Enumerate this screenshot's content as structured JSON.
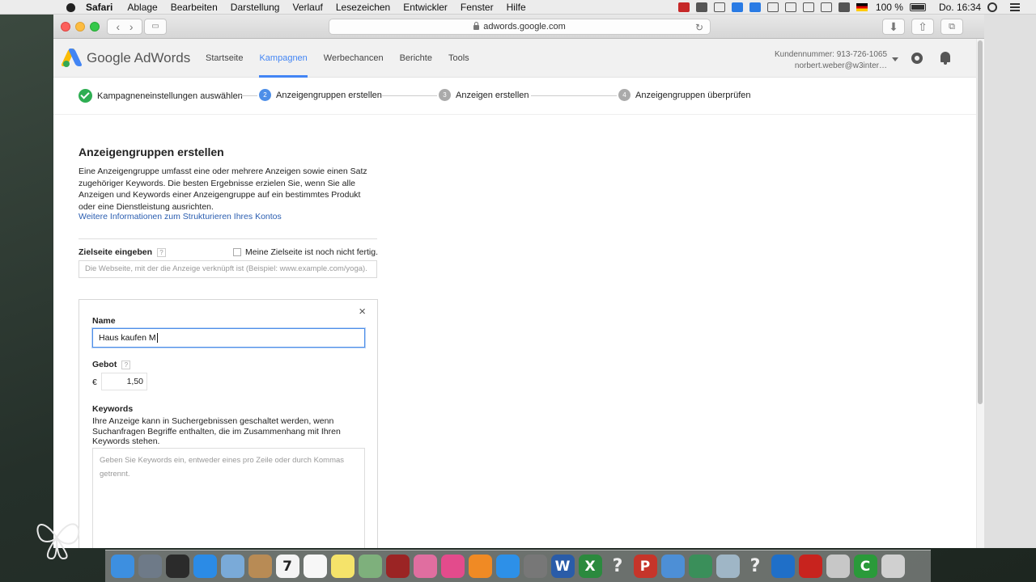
{
  "menubar": {
    "app": "Safari",
    "items": [
      "Ablage",
      "Bearbeiten",
      "Darstellung",
      "Verlauf",
      "Lesezeichen",
      "Entwickler",
      "Fenster",
      "Hilfe"
    ],
    "battery": "100 %",
    "clock": "Do. 16:34"
  },
  "browser": {
    "url": "adwords.google.com"
  },
  "adwords": {
    "brand": "Google AdWords",
    "nav": [
      "Startseite",
      "Kampagnen",
      "Werbechancen",
      "Berichte",
      "Tools"
    ],
    "active_nav": "Kampagnen",
    "account_id": "Kundennummer: 913-726-1065",
    "account_email": "norbert.weber@w3inter…"
  },
  "steps": [
    {
      "num": "",
      "label": "Kampagneneinstellungen auswählen",
      "state": "done"
    },
    {
      "num": "2",
      "label": "Anzeigengruppen erstellen",
      "state": "current"
    },
    {
      "num": "3",
      "label": "Anzeigen erstellen",
      "state": "pending"
    },
    {
      "num": "4",
      "label": "Anzeigengruppen überprüfen",
      "state": "pending"
    }
  ],
  "content": {
    "title": "Anzeigengruppen erstellen",
    "intro": "Eine Anzeigengruppe umfasst eine oder mehrere Anzeigen sowie einen Satz zugehöriger Keywords. Die besten Ergebnisse erzielen Sie, wenn Sie alle Anzeigen und Keywords einer Anzeigengruppe auf ein bestimmtes Produkt oder eine Dienstleistung ausrichten.",
    "intro_link": "Weitere Informationen zum Strukturieren Ihres Kontos",
    "landing_label": "Zielseite eingeben",
    "help_mark": "?",
    "landing_checkbox": "Meine Zielseite ist noch nicht fertig.",
    "landing_placeholder": "Die Webseite, mit der die Anzeige verknüpft ist (Beispiel: www.example.com/yoga)."
  },
  "adgroup_card": {
    "close": "×",
    "name_label": "Name",
    "name_value": "Haus kaufen M",
    "bid_label": "Gebot",
    "currency": "€",
    "bid_value": "1,50",
    "keywords_label": "Keywords",
    "keywords_desc": "Ihre Anzeige kann in Suchergebnissen geschaltet werden, wenn Suchanfragen Begriffe enthalten, die im Zusammenhang mit Ihren Keywords stehen.",
    "keywords_placeholder": "Geben Sie Keywords ein, entweder eines pro Zeile oder durch Kommas getrennt."
  },
  "dock": [
    {
      "name": "finder-icon",
      "color": "#3d8fe0",
      "glyph": ""
    },
    {
      "name": "launchpad-icon",
      "color": "#6e7a88",
      "glyph": ""
    },
    {
      "name": "mission-control-icon",
      "color": "#2b2b2b",
      "glyph": ""
    },
    {
      "name": "safari-icon",
      "color": "#2b8be6",
      "glyph": ""
    },
    {
      "name": "mail-icon",
      "color": "#7aaad8",
      "glyph": ""
    },
    {
      "name": "contacts-icon",
      "color": "#b88b55",
      "glyph": ""
    },
    {
      "name": "calendar-icon",
      "color": "#f4f4f4",
      "glyph": "7"
    },
    {
      "name": "notes-list-icon",
      "color": "#f7f7f7",
      "glyph": ""
    },
    {
      "name": "stickies-icon",
      "color": "#f5e36a",
      "glyph": ""
    },
    {
      "name": "preview-icon",
      "color": "#7eb07c",
      "glyph": ""
    },
    {
      "name": "photo-booth-icon",
      "color": "#9b2424",
      "glyph": ""
    },
    {
      "name": "photos-icon",
      "color": "#e06ea0",
      "glyph": ""
    },
    {
      "name": "itunes-icon",
      "color": "#e34b8c",
      "glyph": ""
    },
    {
      "name": "ibooks-icon",
      "color": "#f08a24",
      "glyph": ""
    },
    {
      "name": "app-store-icon",
      "color": "#2d90e8",
      "glyph": ""
    },
    {
      "name": "system-preferences-icon",
      "color": "#777777",
      "glyph": ""
    },
    {
      "name": "word-icon",
      "color": "#2a5ca8",
      "glyph": "W"
    },
    {
      "name": "excel-icon",
      "color": "#2b8a3e",
      "glyph": "X"
    },
    {
      "name": "unknown-app-icon",
      "color": "#b0b0b0",
      "glyph": "?"
    },
    {
      "name": "powerpoint-icon",
      "color": "#c6352a",
      "glyph": "P"
    },
    {
      "name": "users-icon",
      "color": "#4d8fd6",
      "glyph": ""
    },
    {
      "name": "network-globe-icon",
      "color": "#3a8f5a",
      "glyph": ""
    },
    {
      "name": "tools-icon",
      "color": "#9fb6c6",
      "glyph": ""
    },
    {
      "name": "unknown-app-2-icon",
      "color": "#b0b0b0",
      "glyph": "?"
    },
    {
      "name": "teamviewer-icon",
      "color": "#1f6fc8",
      "glyph": ""
    },
    {
      "name": "acrobat-icon",
      "color": "#c8231e",
      "glyph": ""
    },
    {
      "name": "gem-icon",
      "color": "#c7c7c7",
      "glyph": ""
    },
    {
      "name": "camtasia-icon",
      "color": "#2a9a3a",
      "glyph": "C"
    },
    {
      "name": "trash-icon",
      "color": "#d0d0d0",
      "glyph": ""
    }
  ]
}
